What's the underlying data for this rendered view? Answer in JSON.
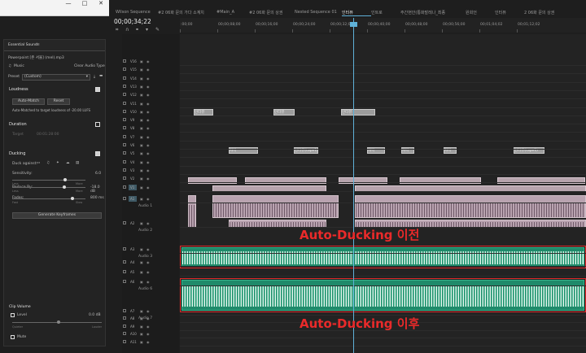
{
  "colors": {
    "accent": "#5fb1d8",
    "annotation": "#ea2a2a",
    "audio_clip": "#b9a3b0",
    "ducked_audio": "#1f8a6a",
    "panel_bg": "#232323"
  },
  "window": {
    "minimize": "—",
    "maximize": "□",
    "close": "✕"
  },
  "essential_sound": {
    "title": "Essential Sound",
    "menu_icon": "≡",
    "clip_name": "Powerpoint [존 서울] (mel).mp3",
    "type_label": "Music",
    "clear_label": "Clear Audio Type",
    "preset_label": "Preset",
    "preset_value": "(Custom)",
    "loudness": {
      "title": "Loudness",
      "auto_match": "Auto-Match",
      "reset": "Reset",
      "note": "Auto-Matched to target loudness of -20.00 LUFS"
    },
    "duration": {
      "title": "Duration",
      "target_label": "Target",
      "target_value": "00:01:28:00"
    },
    "ducking": {
      "title": "Ducking",
      "duck_against": "Duck against:",
      "sensitivity": "Sensitivity:",
      "sens_low": "Less",
      "sens_high": "More",
      "sens_value": "6.0",
      "reduce_by": "Reduce By:",
      "reduce_low": "Less",
      "reduce_high": "More",
      "reduce_value": "-18.0 dB",
      "fades": "Fades:",
      "fades_low": "Fast",
      "fades_high": "Slow",
      "fades_value": "800 ms",
      "generate": "Generate Keyframes"
    },
    "clip_volume": {
      "title": "Clip Volume",
      "level": "Level",
      "level_value": "0.0 dB",
      "low": "Quieter",
      "high": "Louder",
      "mute": "Mute"
    }
  },
  "tabs": [
    "Wilson Sequence",
    "#2 06화 문의 가다 소계치",
    "#Main_A",
    "#2 06화 문의 상권",
    "Nested Sequence 01",
    "인터뷰",
    "인트로",
    "주간현안(통화발레나_최종",
    "원희언",
    "인터뷰",
    "2 06화 문의 상권"
  ],
  "active_tab_index": 5,
  "timecode": "00;00;34;22",
  "toolbar_icons": [
    "snap-icon",
    "magnet-icon",
    "linked-icon",
    "marker-icon",
    "wrench-icon"
  ],
  "ruler_labels": [
    ":00;00",
    "00;00;08;00",
    "00;00;16;00",
    "00;00;24;00",
    "00;00;32;00",
    "00;00;40;00",
    "00;00;48;00",
    "00;00;56;00",
    "00;01;04;02",
    "00;01;12;02"
  ],
  "video_tracks": [
    "V16",
    "V15",
    "V14",
    "V13",
    "V12",
    "V11",
    "V10",
    "V9",
    "V8",
    "V7",
    "V6",
    "V5",
    "V4",
    "V3",
    "V2",
    "V1"
  ],
  "audio_tracks": [
    {
      "id": "A1",
      "name": "Audio 1"
    },
    {
      "id": "A2",
      "name": "Audio 2"
    },
    {
      "id": "A3",
      "name": "Audio 3"
    },
    {
      "id": "A4",
      "name": ""
    },
    {
      "id": "A5",
      "name": ""
    },
    {
      "id": "A6",
      "name": "Audio 6"
    },
    {
      "id": "A7",
      "name": "Audio 7"
    },
    {
      "id": "A8",
      "name": ""
    },
    {
      "id": "A9",
      "name": ""
    },
    {
      "id": "A10",
      "name": ""
    },
    {
      "id": "A11",
      "name": ""
    }
  ],
  "clip_labels": {
    "interview": "인터뷰",
    "caption": "자막",
    "interview_wide": "인터뷰(tape1)",
    "fx": "fx"
  },
  "annotations": {
    "before": "Auto-Ducking 이전",
    "after": "Auto-Ducking 이후"
  }
}
